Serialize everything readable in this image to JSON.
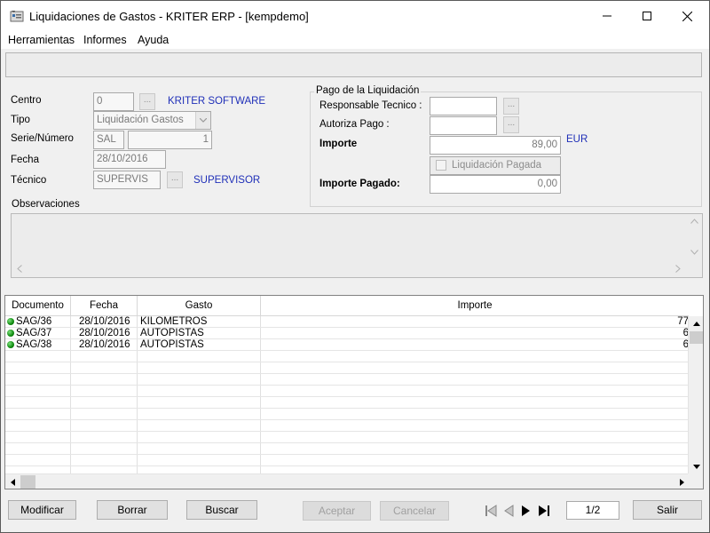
{
  "window": {
    "title": "Liquidaciones de Gastos - KRITER ERP - [kempdemo]"
  },
  "menu": [
    {
      "label": "Herramientas"
    },
    {
      "label": "Informes"
    },
    {
      "label": "Ayuda"
    }
  ],
  "form": {
    "centro": {
      "label": "Centro",
      "value": "0",
      "name": "KRITER SOFTWARE"
    },
    "tipo": {
      "label": "Tipo",
      "value": "Liquidación Gastos"
    },
    "serie": {
      "label": "Serie/Número",
      "serie": "SAL",
      "numero": "1"
    },
    "fecha": {
      "label": "Fecha",
      "value": "28/10/2016"
    },
    "tecnico": {
      "label": "Técnico",
      "value": "SUPERVIS",
      "name": "SUPERVISOR"
    },
    "observaciones": {
      "label": "Observaciones",
      "value": ""
    }
  },
  "pago": {
    "legend": "Pago de la Liquidación",
    "responsable": {
      "label": "Responsable Tecnico :",
      "value": ""
    },
    "autoriza": {
      "label": "Autoriza Pago :",
      "value": ""
    },
    "importe": {
      "label": "Importe",
      "value": "89,00",
      "currency": "EUR"
    },
    "pagada": {
      "label": "Liquidación Pagada",
      "checked": false
    },
    "importe_pagado": {
      "label": "Importe Pagado:",
      "value": "0,00"
    }
  },
  "ellipsis": "...",
  "grid": {
    "headers": [
      "Documento",
      "Fecha",
      "Gasto",
      "Importe"
    ],
    "rows": [
      {
        "documento": "SAG/36",
        "fecha": "28/10/2016",
        "gasto": "KILOMETROS",
        "importe": "77"
      },
      {
        "documento": "SAG/37",
        "fecha": "28/10/2016",
        "gasto": "AUTOPISTAS",
        "importe": "6"
      },
      {
        "documento": "SAG/38",
        "fecha": "28/10/2016",
        "gasto": "AUTOPISTAS",
        "importe": "6"
      }
    ],
    "status_color": "#0e8a0e"
  },
  "buttons": {
    "modificar": "Modificar",
    "borrar": "Borrar",
    "buscar": "Buscar",
    "aceptar": "Aceptar",
    "cancelar": "Cancelar",
    "salir": "Salir"
  },
  "pager": {
    "value": "1/2"
  },
  "colors": {
    "accent_text": "#1f2fb8",
    "window_bg": "#f0f0f0"
  }
}
